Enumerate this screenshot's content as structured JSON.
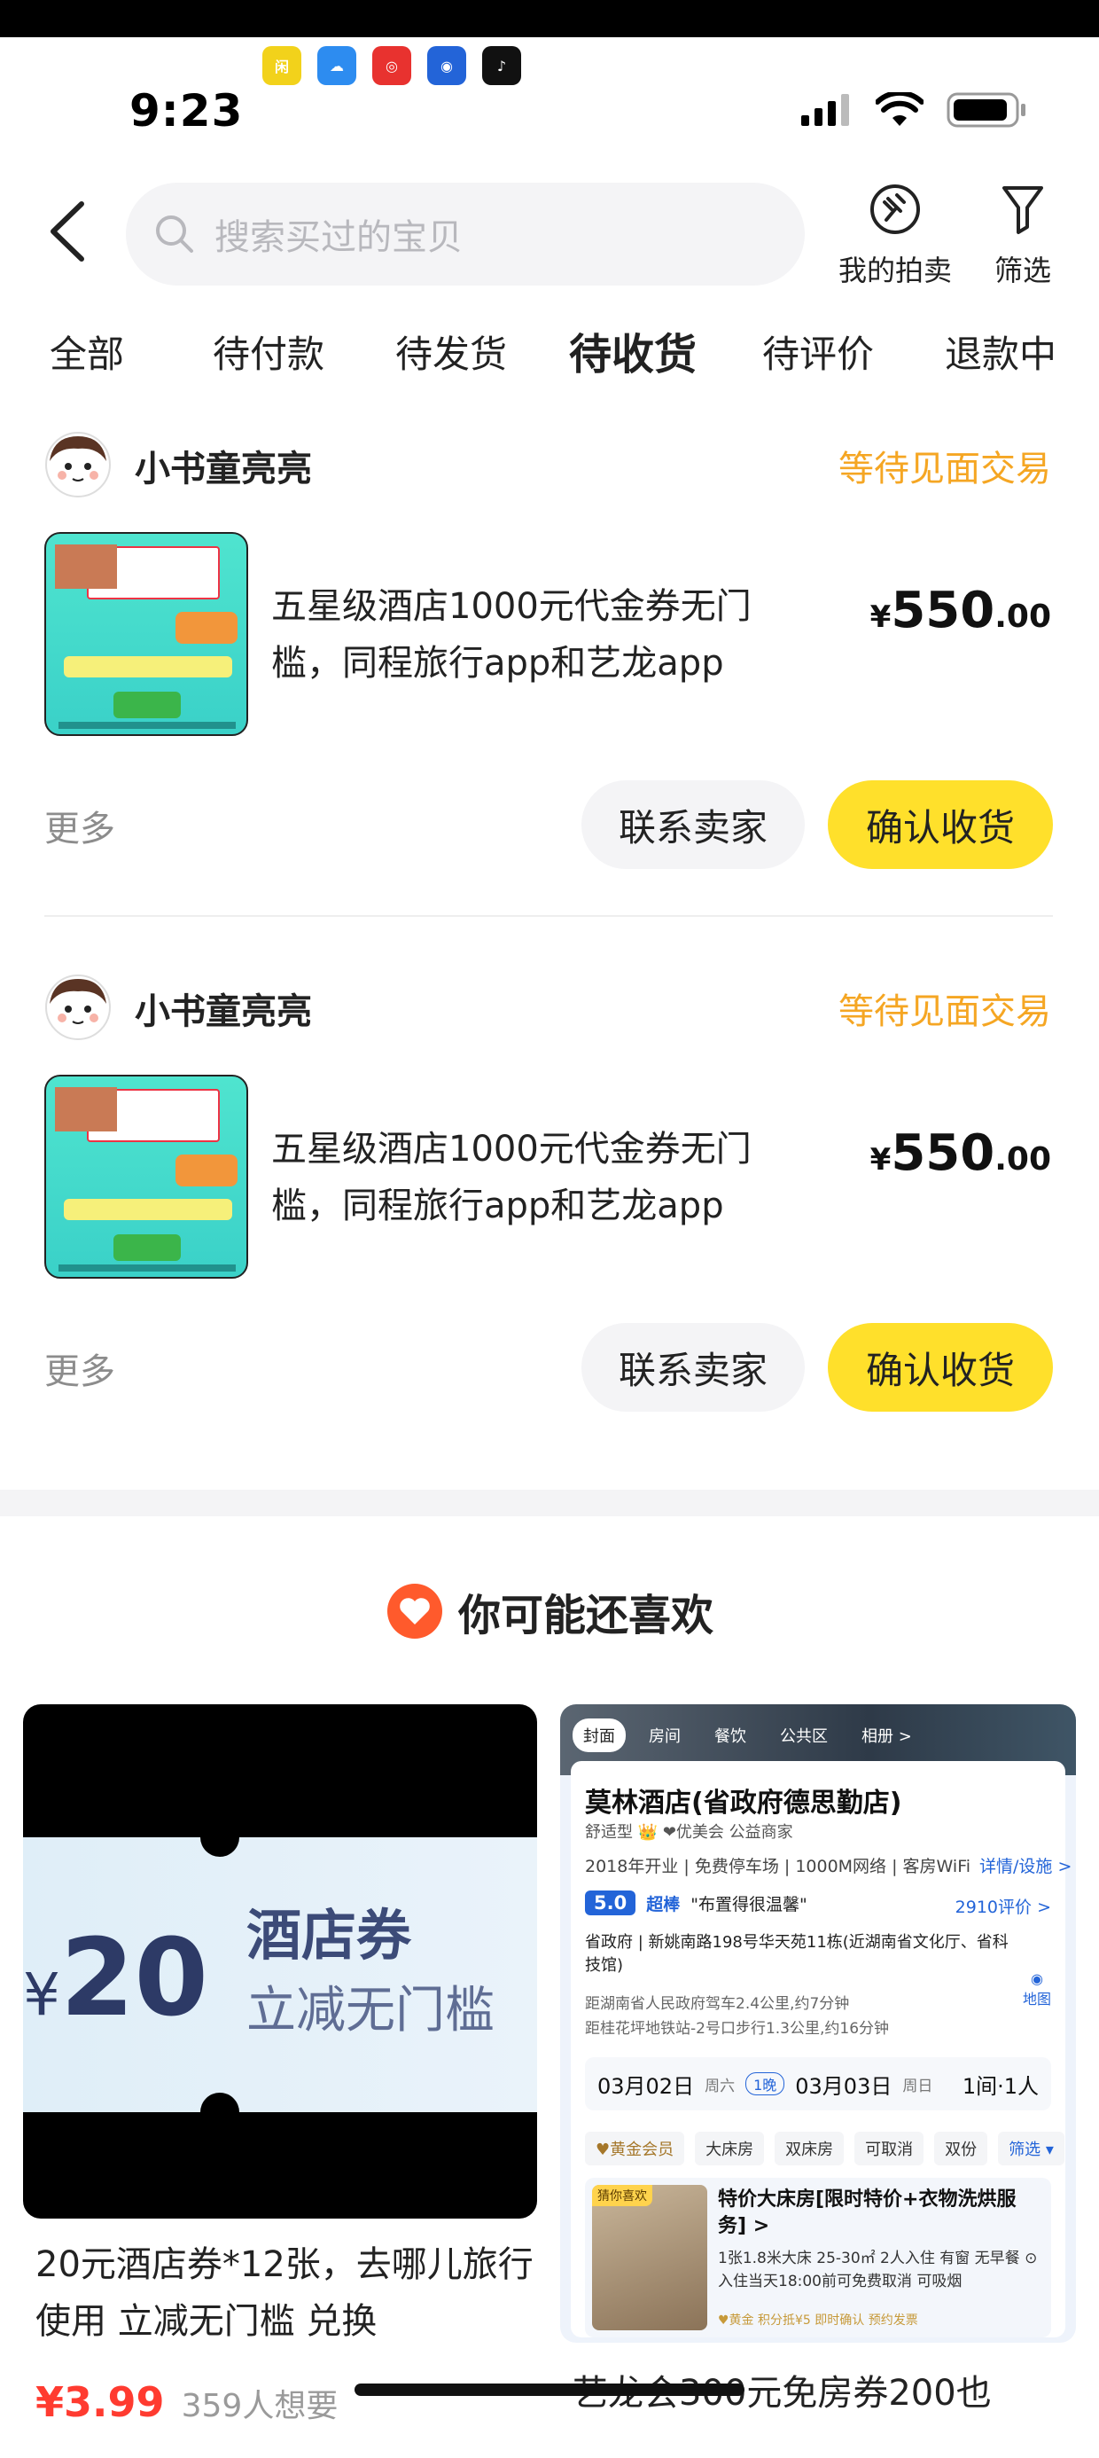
{
  "status_bar": {
    "time": "9:23",
    "app_icons": [
      {
        "name": "app-icon-1",
        "color": "#f2d21b",
        "glyph": "闲"
      },
      {
        "name": "app-icon-2",
        "color": "#2d8cf0",
        "glyph": "☁"
      },
      {
        "name": "app-icon-3",
        "color": "#e8322f",
        "glyph": "◎"
      },
      {
        "name": "app-icon-4",
        "color": "#2364d8",
        "glyph": "◉"
      },
      {
        "name": "app-icon-5",
        "color": "#111111",
        "glyph": "♪"
      }
    ]
  },
  "header": {
    "search_placeholder": "搜索买过的宝贝",
    "my_auction_label": "我的拍卖",
    "filter_label": "筛选"
  },
  "tabs": [
    {
      "label": "全部",
      "active": false
    },
    {
      "label": "待付款",
      "active": false
    },
    {
      "label": "待发货",
      "active": false
    },
    {
      "label": "待收货",
      "active": true
    },
    {
      "label": "待评价",
      "active": false
    },
    {
      "label": "退款中",
      "active": false
    }
  ],
  "orders": [
    {
      "seller": "小书童亮亮",
      "status": "等待见面交易",
      "title": "五星级酒店1000元代金券无门槛，同程旅行app和艺龙app",
      "price_currency": "¥",
      "price_int": "550",
      "price_dec": ".00",
      "more": "更多",
      "contact_label": "联系卖家",
      "confirm_label": "确认收货"
    },
    {
      "seller": "小书童亮亮",
      "status": "等待见面交易",
      "title": "五星级酒店1000元代金券无门槛，同程旅行app和艺龙app",
      "price_currency": "¥",
      "price_int": "550",
      "price_dec": ".00",
      "more": "更多",
      "contact_label": "联系卖家",
      "confirm_label": "确认收货"
    }
  ],
  "recommend": {
    "title": "你可能还喜欢",
    "left": {
      "coupon_currency": "¥",
      "coupon_amount": "20",
      "coupon_line1": "酒店券",
      "coupon_line2": "立减无门槛",
      "desc": "20元酒店券*12张，去哪儿旅行使用 立减无门槛 兑换",
      "price": "¥3.99",
      "wants": "359人想要"
    },
    "right": {
      "tabs": [
        "封面",
        "房间",
        "餐饮",
        "公共区",
        "相册 >"
      ],
      "hotel_name": "莫林酒店(省政府德思勤店)",
      "hotel_sub": "舒适型 👑  ❤优美会  公益商家",
      "facilities": "2018年开业 | 免费停车场 | 1000M网络 | 客房WiFi",
      "facilities_link": "详情/设施 >",
      "score": "5.0",
      "score_word": "超棒",
      "score_quote": "\"布置得很温馨\"",
      "reviews": "2910评价 >",
      "address": "省政府 | 新姚南路198号华天苑11栋(近湖南省文化厅、省科技馆)",
      "distance1": "距湖南省人民政府驾车2.4公里,约7分钟",
      "distance2": "距桂花坪地铁站-2号口步行1.3公里,约16分钟",
      "map_label": "地图",
      "checkin_date": "03月02日",
      "checkin_week": "周六",
      "nights": "1晚",
      "checkout_date": "03月03日",
      "checkout_week": "周日",
      "rooms": "1间·1人",
      "filter_chips": [
        "♥黄金会员",
        "大床房",
        "双床房",
        "可取消",
        "双份",
        "筛选 ▾"
      ],
      "room_badge": "猜你喜欢",
      "room_title": "特价大床房[限时特价+衣物洗烘服务] >",
      "room_detail": "1张1.8米大床 25-30㎡ 2人入住 有窗 无早餐 ⊙入住当天18:00前可免费取消 可吸烟",
      "room_tags": "♥黄金  积分抵¥5  即时确认  预约发票",
      "desc": "艺龙会300元免房券200也"
    }
  }
}
